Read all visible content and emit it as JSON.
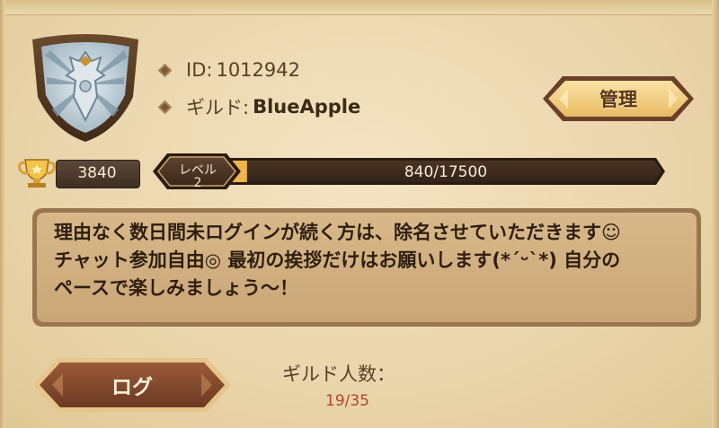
{
  "profile": {
    "id_label": "ID:",
    "id_value": "1012942",
    "guild_label": "ギルド:",
    "guild_name": "BlueApple"
  },
  "buttons": {
    "manage_label": "管理",
    "log_label": "ログ"
  },
  "stats": {
    "trophy_value": "3840",
    "level_label": "レベル\n2",
    "xp_text": "840/17500",
    "xp_fraction": 0.048
  },
  "message": {
    "text": "理由なく数日間未ログインが続く方は、除名させていただきます☺\nチャット参加自由◎ 最初の挨拶だけはお願いします(*ˊᵕˋ*) 自分の\nペースで楽しみましょう～！"
  },
  "members": {
    "label": "ギルド人数：",
    "count": "19/35"
  },
  "colors": {
    "accent_text": "#b0442a",
    "button_gold": "#f2cf86",
    "button_dark": "#6a4028"
  }
}
